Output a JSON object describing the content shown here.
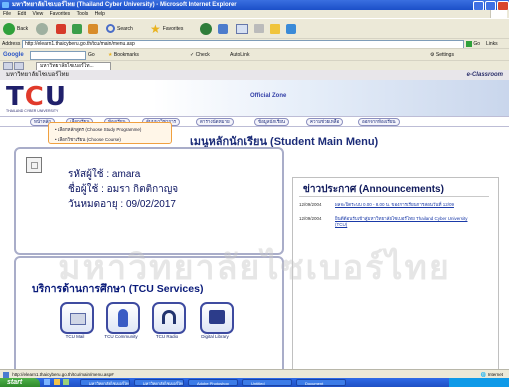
{
  "window": {
    "title": "มหาวิทยาลัยไซเบอร์ไทย (Thailand Cyber University) - Microsoft Internet Explorer"
  },
  "menubar": {
    "items": [
      "File",
      "Edit",
      "View",
      "Favorites",
      "Tools",
      "Help"
    ]
  },
  "toolbar": {
    "back": "Back",
    "search": "Search",
    "favorites": "Favorites"
  },
  "address": {
    "label": "Address",
    "url": "http://elearn1.thaicyberu.go.th/tcu/main/menu.asp",
    "go": "Go",
    "links": "Links"
  },
  "googlebar": {
    "brand": "Google",
    "go": "Go",
    "bookmarks": "Bookmarks",
    "check": "Check",
    "autolink": "AutoLink",
    "settings": "Settings"
  },
  "tabs": [
    {
      "label": "มหาวิทยาลัยไซเบอร์ไท..."
    }
  ],
  "site": {
    "header_thai": "มหาวิทยาลัยไซเบอร์ไทย",
    "eclassroom": "e-Classroom",
    "official_zone": "Official Zone",
    "logo_t": "T",
    "logo_c": "C",
    "logo_u": "U",
    "logo_sub": "THAILAND CYBER UNIVERSITY",
    "nav": [
      "หน้าหลัก",
      "เลือกเรียน",
      "ห้องเรียน",
      "สัมมนาวิชาการ",
      "ตารางนัดหมาย",
      "ข้อมูลนักเรียน",
      "ความช่วยเหลือ",
      "ออกจากห้องเรียน"
    ],
    "popup": [
      "เลือกหลักสูตร (Choose Study Programme)",
      "เลือกวิชาเรียน (Choose Course)"
    ],
    "main_title": "เมนูหลักนักเรียน (Student Main Menu)",
    "student": {
      "username_label": "รหัสผู้ใช้ : amara",
      "name_label": "ชื่อผู้ใช้ : อมรา  กิตติกาญจ",
      "expiry_label": "วันหมดอายุ : 09/02/2017"
    },
    "services": {
      "title": "บริการด้านการศึกษา (TCU Services)",
      "items": [
        {
          "label": "TCU Mail",
          "icon": "mail-icon"
        },
        {
          "label": "TCU Community",
          "icon": "community-icon"
        },
        {
          "label": "TCU Radio",
          "icon": "radio-icon"
        },
        {
          "label": "Digital Library",
          "icon": "library-icon"
        }
      ]
    },
    "announcements": {
      "title": "ข่าวประกาศ (Announcements)",
      "items": [
        {
          "date": "12/09/2004",
          "text": "ผลจะปิดระบบ 0.00 - 8.00 น. ของการเรียนการสอนวันที่ 12/09"
        },
        {
          "date": "12/09/2004",
          "text": "ยินดีต้อนรับเข้าสู่มหาวิทยาลัยไซเบอร์ไทย Thailand Cyber University (TCU)"
        }
      ]
    },
    "watermark": "มหาวิทยาลัยไซเบอร์ไทย"
  },
  "status": {
    "url": "http://elearn1.thaicyberu.go.th/tcu/main/menu.asp#",
    "zone": "Internet"
  },
  "taskbar": {
    "start": "start",
    "items": [
      "มหาวิทยาลัยไซเบอร์ไทย",
      "มหาวิทยาลัยไซเบอร์ไทย",
      "Adobe Photoshop",
      "Untitled",
      "Document"
    ]
  }
}
